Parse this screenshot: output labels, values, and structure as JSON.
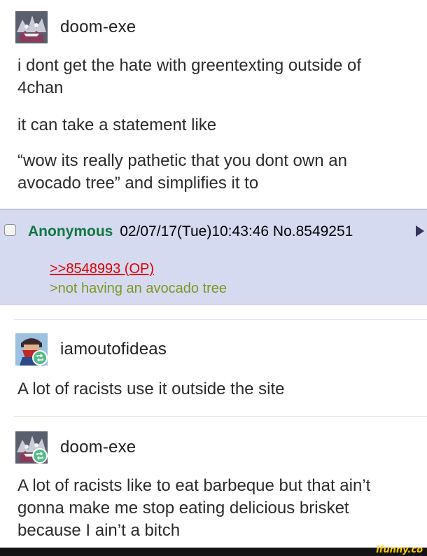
{
  "posts": [
    {
      "username": "doom-exe"
    },
    {
      "username": "iamoutofideas"
    },
    {
      "username": "doom-exe"
    }
  ],
  "post1": {
    "p1": "i dont get the hate with greentexting outside of 4chan",
    "p2": "it can take a statement like",
    "p3": "“wow its really pathetic that you dont own an avocado tree” and simplifies it to"
  },
  "chan": {
    "name": "Anonymous",
    "meta": "02/07/17(Tue)10:43:46 No.8549251",
    "quote_link": ">>8548993 (OP)",
    "greentext": ">not having an avocado tree"
  },
  "post2": {
    "text": "A lot of racists use it outside the site"
  },
  "post3": {
    "text": "A lot of racists like to eat barbeque but that ain’t gonna make me stop eating delicious brisket because I ain’t a bitch"
  },
  "watermark": "ifunny.co"
}
